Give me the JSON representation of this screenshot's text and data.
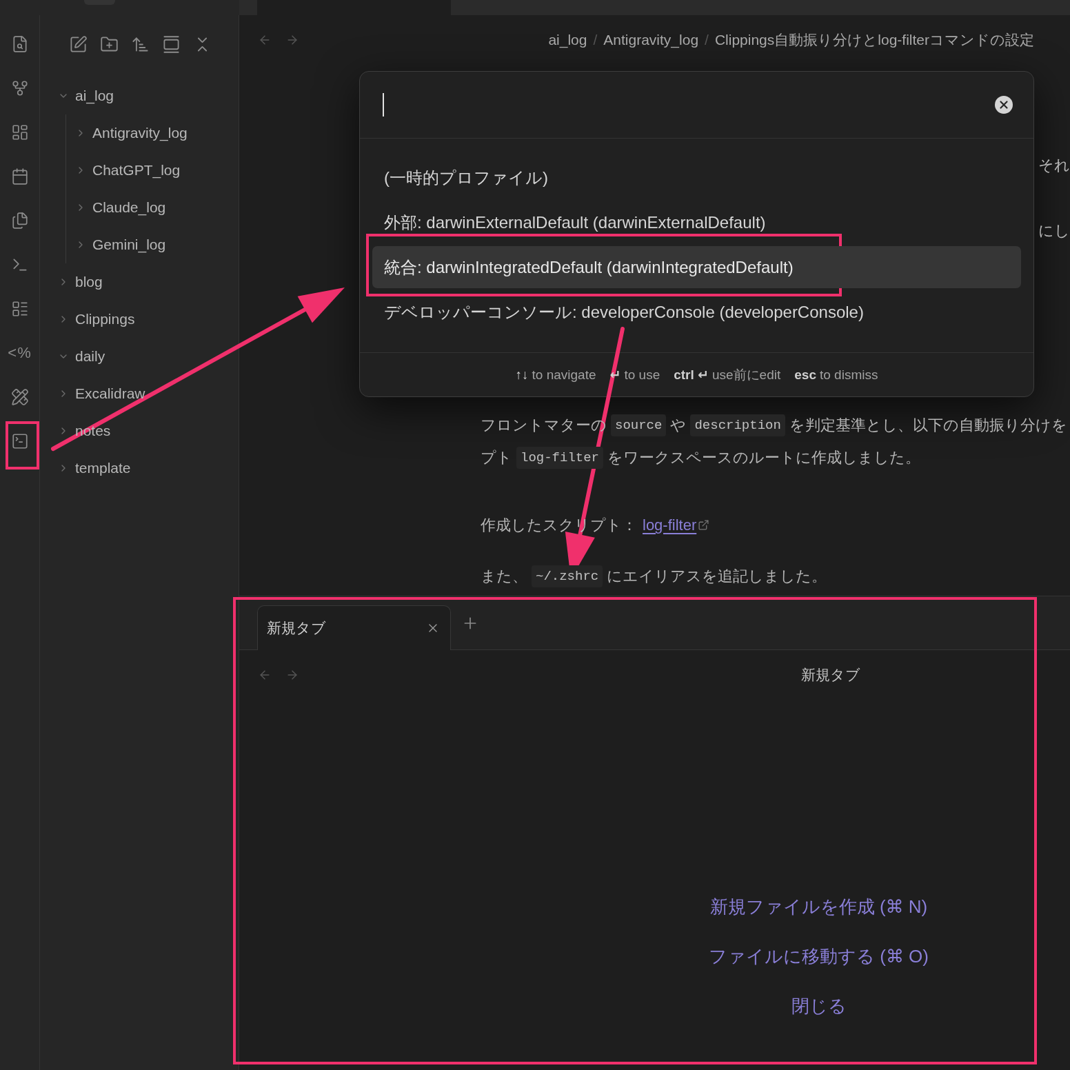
{
  "ribbon": {
    "template_glyph": "<%"
  },
  "file_explorer": {
    "tree": [
      {
        "label": "ai_log",
        "expanded": true,
        "children": [
          {
            "label": "Antigravity_log",
            "expanded": false
          },
          {
            "label": "ChatGPT_log",
            "expanded": false
          },
          {
            "label": "Claude_log",
            "expanded": false
          },
          {
            "label": "Gemini_log",
            "expanded": false
          }
        ]
      },
      {
        "label": "blog",
        "expanded": false
      },
      {
        "label": "Clippings",
        "expanded": false
      },
      {
        "label": "daily",
        "expanded": true
      },
      {
        "label": "Excalidraw",
        "expanded": false
      },
      {
        "label": "notes",
        "expanded": false
      },
      {
        "label": "template",
        "expanded": false
      }
    ]
  },
  "editor": {
    "breadcrumb": {
      "separator": "/",
      "items": [
        "ai_log",
        "Antigravity_log",
        "Clippings自動振り分けとlog-filterコマンドの設定"
      ]
    },
    "lines": [
      {
        "kind": "fragment",
        "segments": [
          {
            "kind": "text",
            "text": "それ"
          }
        ]
      },
      {
        "kind": "fragment",
        "segments": [
          {
            "kind": "text",
            "text": "にし"
          }
        ]
      },
      {
        "kind": "line",
        "segments": [
          {
            "kind": "text",
            "text": "フロントマターの"
          },
          {
            "kind": "code",
            "text": "source"
          },
          {
            "kind": "text",
            "text": "や"
          },
          {
            "kind": "code",
            "text": "description"
          },
          {
            "kind": "text",
            "text": "を判定基準とし、以下の自動振り分けを"
          }
        ]
      },
      {
        "kind": "line",
        "segments": [
          {
            "kind": "text",
            "text": "プト"
          },
          {
            "kind": "code",
            "text": "log-filter"
          },
          {
            "kind": "text",
            "text": "をワークスペースのルートに作成しました。"
          }
        ]
      },
      {
        "kind": "line",
        "segments": [
          {
            "kind": "text",
            "text": "作成したスクリプト："
          },
          {
            "kind": "link",
            "text": "log-filter"
          }
        ]
      },
      {
        "kind": "line",
        "segments": [
          {
            "kind": "text",
            "text": "また、"
          },
          {
            "kind": "code",
            "text": "~/.zshrc"
          },
          {
            "kind": "text",
            "text": "にエイリアスを追記しました。"
          }
        ]
      }
    ]
  },
  "command_palette": {
    "items": [
      {
        "label": "(一時的プロファイル)",
        "selected": false
      },
      {
        "label": "外部: darwinExternalDefault (darwinExternalDefault)",
        "selected": false
      },
      {
        "label": "統合: darwinIntegratedDefault (darwinIntegratedDefault)",
        "selected": true
      },
      {
        "label": "デベロッパーコンソール: developerConsole (developerConsole)",
        "selected": false
      }
    ],
    "instructions": [
      {
        "key": "↑↓",
        "text": "to navigate"
      },
      {
        "key": "↵",
        "text": "to use"
      },
      {
        "key": "ctrl ↵",
        "text": "use前にedit"
      },
      {
        "key": "esc",
        "text": "to dismiss"
      }
    ]
  },
  "bottom_pane": {
    "tabs": [
      {
        "label": "新規タブ",
        "selected": true
      }
    ],
    "title": "新規タブ",
    "actions": [
      "新規ファイルを作成 (⌘ N)",
      "ファイルに移動する (⌘ O)",
      "閉じる"
    ]
  }
}
